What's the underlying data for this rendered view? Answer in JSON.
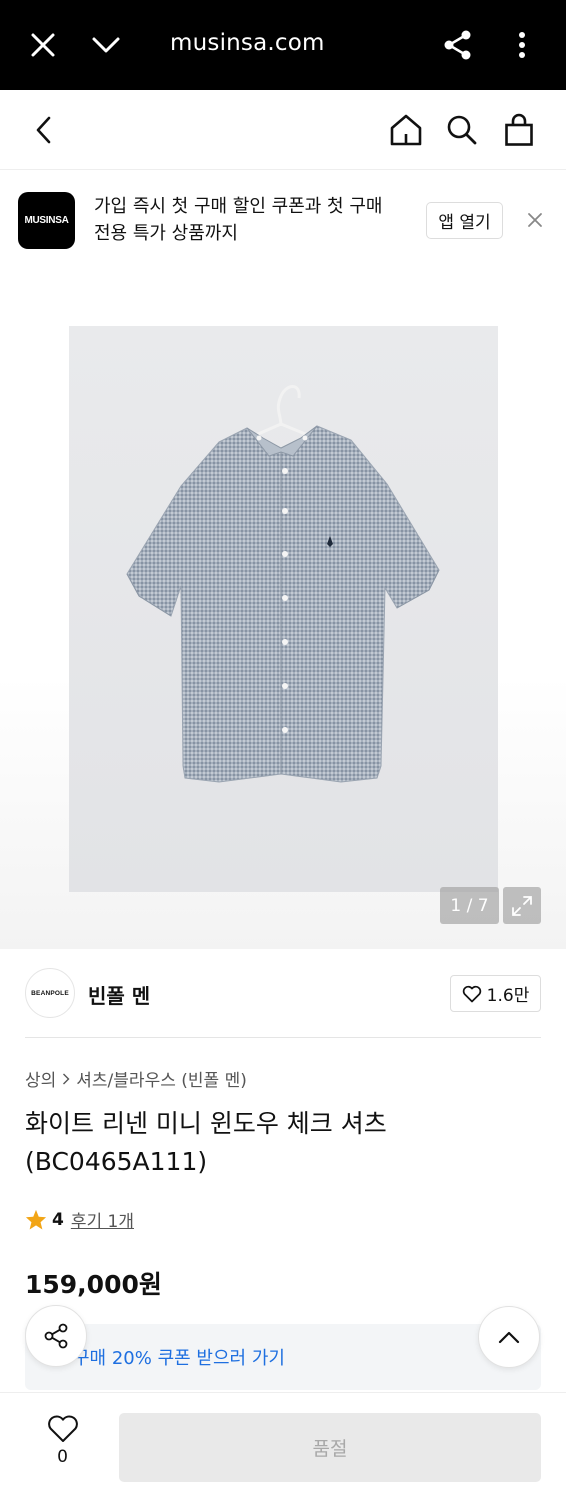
{
  "browser": {
    "url": "musinsa.com",
    "icons": [
      "close-icon",
      "chevron-down-icon",
      "share-icon",
      "more-vertical-icon"
    ]
  },
  "header": {
    "icons": [
      "back-icon",
      "home-icon",
      "search-icon",
      "shopping-bag-icon"
    ]
  },
  "banner": {
    "logo_text": "MUSINSA",
    "message": "가입 즉시 첫 구매 할인 쿠폰과 첫 구매 전용 특가 상품까지",
    "open_app_label": "앱 열기",
    "close_icon": "close-icon"
  },
  "gallery": {
    "counter": "1 / 7",
    "current": 1,
    "total": 7,
    "expand_icon": "expand-icon"
  },
  "brand": {
    "logo_text": "BEANPOLE",
    "name": "빈폴 멘",
    "like_count": "1.6만"
  },
  "breadcrumb": {
    "items": [
      "상의",
      "셔츠/블라우스 (빈폴 멘)"
    ]
  },
  "product": {
    "title": "화이트 리넨 미니 윈도우 체크 셔츠 (BC0465A111)",
    "rating": "4",
    "reviews_label": "후기 1개",
    "price": "159,000원",
    "coupon_text": "첫 구매 20% 쿠폰 받으러 가기",
    "coupon_text_visible": "구매 20% 쿠폰 받으러 가기"
  },
  "bottom": {
    "wish_count": "0",
    "cta_label": "품절"
  },
  "colors": {
    "browser_bar": "#000000",
    "coupon_text": "#1e6fe0",
    "star": "#f2a516",
    "soldout_bg": "#e9e9e9"
  }
}
